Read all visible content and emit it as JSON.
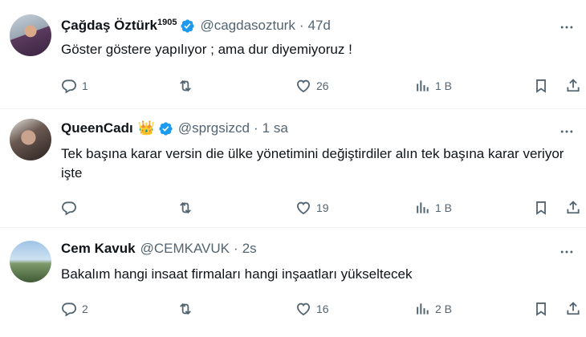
{
  "tweets": [
    {
      "name": "Çağdaş Öztürk",
      "name_sup": "1905",
      "handle": "@cagdasozturk",
      "separator": "·",
      "time": "47d",
      "text": "Göster göstere yapılıyor ; ama dur diyemiyoruz !",
      "replies": "1",
      "retweets": "",
      "likes": "26",
      "views": "1 B"
    },
    {
      "name": "QueenCadı",
      "name_emoji": "👑",
      "handle": "@sprgsizcd",
      "separator": "·",
      "time": "1 sa",
      "text": "Tek başına karar versin die ülke yönetimini değiştirdiler alın tek başına karar veriyor işte",
      "replies": "",
      "retweets": "",
      "likes": "19",
      "views": "1 B"
    },
    {
      "name": "Cem Kavuk",
      "handle": "@CEMKAVUK",
      "separator": "·",
      "time": "2s",
      "text": "Bakalım hangi insaat firmaları hangi inşaatları yükseltecek",
      "replies": "2",
      "retweets": "",
      "likes": "16",
      "views": "2 B"
    }
  ],
  "colors": {
    "text": "#0f1419",
    "secondary": "#536471",
    "verified": "#1d9bf0",
    "divider": "#eff3f4"
  },
  "icons": [
    "reply-icon",
    "retweet-icon",
    "like-icon",
    "views-icon",
    "bookmark-icon",
    "share-icon",
    "more-icon",
    "verified-icon"
  ]
}
